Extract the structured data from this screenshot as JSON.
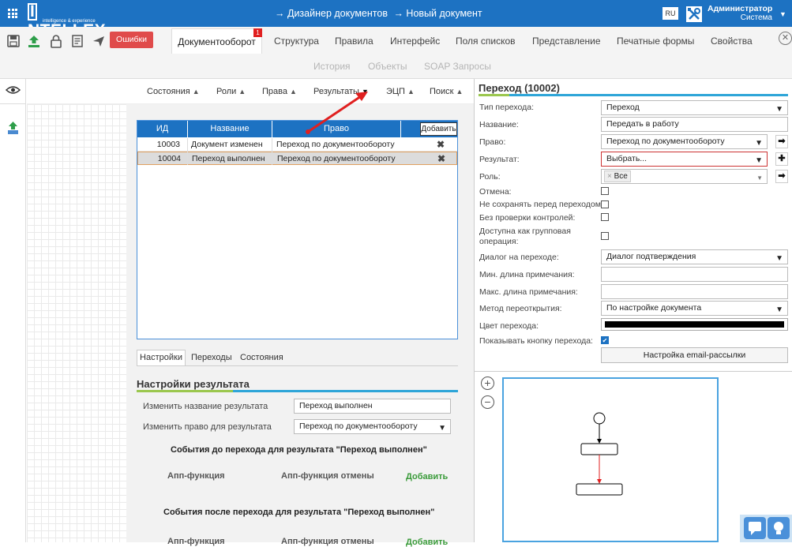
{
  "header": {
    "logo_brand": "INTELLEX",
    "logo_brand_rest": "NTELLEX",
    "logo_tag": "intelligence & experience",
    "breadcrumb": [
      "→ Дизайнер документов",
      "→ Новый документ"
    ],
    "lang": "RU",
    "user_name": "Администратор",
    "user_role": "Система"
  },
  "toolbar": {
    "errors_label": "Ошибки",
    "tabs": [
      "Документооборот",
      "Структура",
      "Правила",
      "Интерфейс",
      "Поля списков",
      "Представление",
      "Печатные формы",
      "Свойства"
    ],
    "active_tab_badge": "1",
    "tabs2": [
      "История",
      "Объекты",
      "SOAP Запросы"
    ]
  },
  "sections": [
    "Состояния",
    "Роли",
    "Права",
    "Результаты",
    "ЭЦП",
    "Поиск"
  ],
  "results_table": {
    "headers": [
      "ИД",
      "Название",
      "Право"
    ],
    "add_label": "Добавить",
    "rows": [
      {
        "id": "10003",
        "name": "Документ изменен",
        "right": "Переход по документообороту"
      },
      {
        "id": "10004",
        "name": "Переход выполнен",
        "right": "Переход по документообороту"
      }
    ]
  },
  "bottom_tabs": [
    "Настройки",
    "Переходы",
    "Состояния"
  ],
  "result_settings": {
    "title": "Настройки результата",
    "rename_label": "Изменить название результата",
    "rename_value": "Переход выполнен",
    "right_label": "Изменить право для результата",
    "right_value": "Переход по документообороту",
    "before_title": "События до перехода для результата \"Переход выполнен\"",
    "app_func": "Апп-функция",
    "app_func_cancel": "Апп-функция отмены",
    "add": "Добавить",
    "after_title": "События после перехода для результата \"Переход выполнен\""
  },
  "transition": {
    "title": "Переход (10002)",
    "type_label": "Тип перехода:",
    "type_value": "Переход",
    "name_label": "Название:",
    "name_value": "Передать в работу",
    "right_label": "Право:",
    "right_value": "Переход по документообороту",
    "result_label": "Результат:",
    "result_value": "Выбрать...",
    "role_label": "Роль:",
    "role_tag": "Все",
    "cancel_label": "Отмена:",
    "nosave_label": "Не сохранять перед переходом:",
    "nocheck_label": "Без проверки контролей:",
    "group_label_1": "Доступна как групповая",
    "group_label_2": "операция:",
    "dialog_label": "Диалог на переходе:",
    "dialog_value": "Диалог подтверждения",
    "min_label": "Мин. длина примечания:",
    "max_label": "Макс. длина примечания:",
    "reopen_label": "Метод переоткрытия:",
    "reopen_value": "По настройке документа",
    "color_label": "Цвет перехода:",
    "color_value": "#000000",
    "showbtn_label": "Показывать кнопку перехода:",
    "email_btn": "Настройка email-рассылки"
  }
}
